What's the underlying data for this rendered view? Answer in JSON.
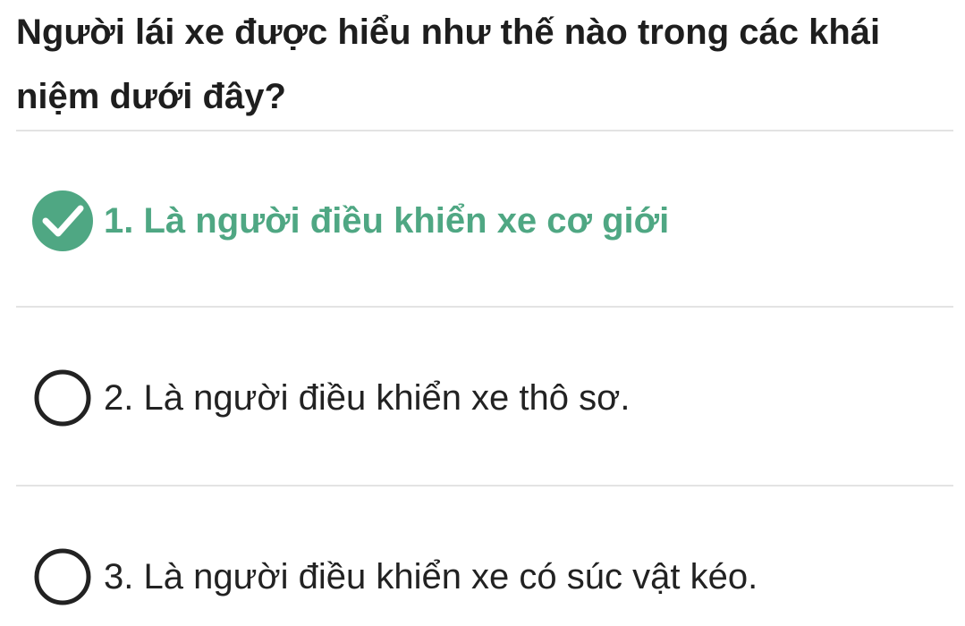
{
  "question": {
    "text": "Người lái xe được hiểu như thế nào trong các khái niệm dưới đây?"
  },
  "options": [
    {
      "label": "1. Là người điều khiển xe cơ giới",
      "state": "correct"
    },
    {
      "label": "2. Là người điều khiển xe thô sơ.",
      "state": "unselected"
    },
    {
      "label": "3. Là người điều khiển xe có súc vật kéo.",
      "state": "unselected"
    }
  ],
  "colors": {
    "correct": "#4fa783",
    "text": "#222222",
    "divider": "#e3e3e3",
    "radio_outline": "#222222"
  },
  "icons": {
    "correct_mark": "check-circle-icon",
    "unselected_mark": "radio-empty-icon"
  }
}
